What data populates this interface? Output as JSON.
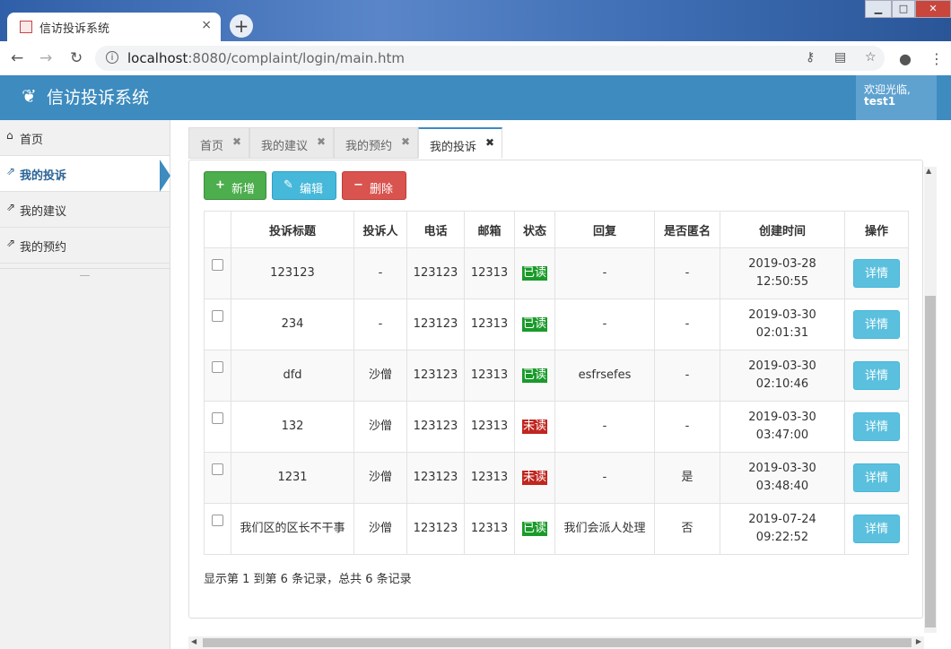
{
  "browser": {
    "tab_title": "信访投诉系统",
    "tab_close": "×",
    "new_tab": "+",
    "url_host": "localhost",
    "url_rest": ":8080/complaint/login/main.htm",
    "window_controls": [
      "▁",
      "□",
      "✕"
    ]
  },
  "app": {
    "title": "信访投诉系统",
    "welcome_line1": "欢迎光临,",
    "welcome_line2": "test1"
  },
  "sidebar": {
    "items": [
      {
        "label": "首页",
        "icon": "home-icon",
        "active": false
      },
      {
        "label": "我的投诉",
        "icon": "link-icon",
        "active": true
      },
      {
        "label": "我的建议",
        "icon": "link-icon",
        "active": false
      },
      {
        "label": "我的预约",
        "icon": "link-icon",
        "active": false
      }
    ],
    "toggle": "—"
  },
  "tabs": [
    {
      "label": "首页",
      "active": false
    },
    {
      "label": "我的建议",
      "active": false
    },
    {
      "label": "我的预约",
      "active": false
    },
    {
      "label": "我的投诉",
      "active": true
    }
  ],
  "toolbar": {
    "add_label": "新增",
    "edit_label": "编辑",
    "delete_label": "删除"
  },
  "table": {
    "headers": [
      "",
      "投诉标题",
      "投诉人",
      "电话",
      "邮箱",
      "状态",
      "回复",
      "是否匿名",
      "创建时间",
      "操作"
    ],
    "rows": [
      {
        "title": "123123",
        "person": "-",
        "phone": "123123",
        "email": "12313",
        "status": "已读",
        "status_type": "read",
        "reply": "-",
        "anonymous": "-",
        "created_date": "2019-03-28",
        "created_time": "12:50:55",
        "action": "详情"
      },
      {
        "title": "234",
        "person": "-",
        "phone": "123123",
        "email": "12313",
        "status": "已读",
        "status_type": "read",
        "reply": "-",
        "anonymous": "-",
        "created_date": "2019-03-30",
        "created_time": "02:01:31",
        "action": "详情"
      },
      {
        "title": "dfd",
        "person": "沙僧",
        "phone": "123123",
        "email": "12313",
        "status": "已读",
        "status_type": "read",
        "reply": "esfrsefes",
        "anonymous": "-",
        "created_date": "2019-03-30",
        "created_time": "02:10:46",
        "action": "详情"
      },
      {
        "title": "132",
        "person": "沙僧",
        "phone": "123123",
        "email": "12313",
        "status": "未读",
        "status_type": "unread",
        "reply": "-",
        "anonymous": "-",
        "created_date": "2019-03-30",
        "created_time": "03:47:00",
        "action": "详情"
      },
      {
        "title": "1231",
        "person": "沙僧",
        "phone": "123123",
        "email": "12313",
        "status": "未读",
        "status_type": "unread",
        "reply": "-",
        "anonymous": "是",
        "created_date": "2019-03-30",
        "created_time": "03:48:40",
        "action": "详情"
      },
      {
        "title": "我们区的区长不干事",
        "person": "沙僧",
        "phone": "123123",
        "email": "12313",
        "status": "已读",
        "status_type": "read",
        "reply": "我们会派人处理",
        "anonymous": "否",
        "created_date": "2019-07-24",
        "created_time": "09:22:52",
        "action": "详情"
      }
    ]
  },
  "pager": {
    "text": "显示第 1 到第 6 条记录，总共 6 条记录"
  },
  "colors": {
    "header": "#3d8bbf",
    "read": "#1a9a2a",
    "unread": "#c0261f",
    "detail_button": "#5bc0de"
  }
}
